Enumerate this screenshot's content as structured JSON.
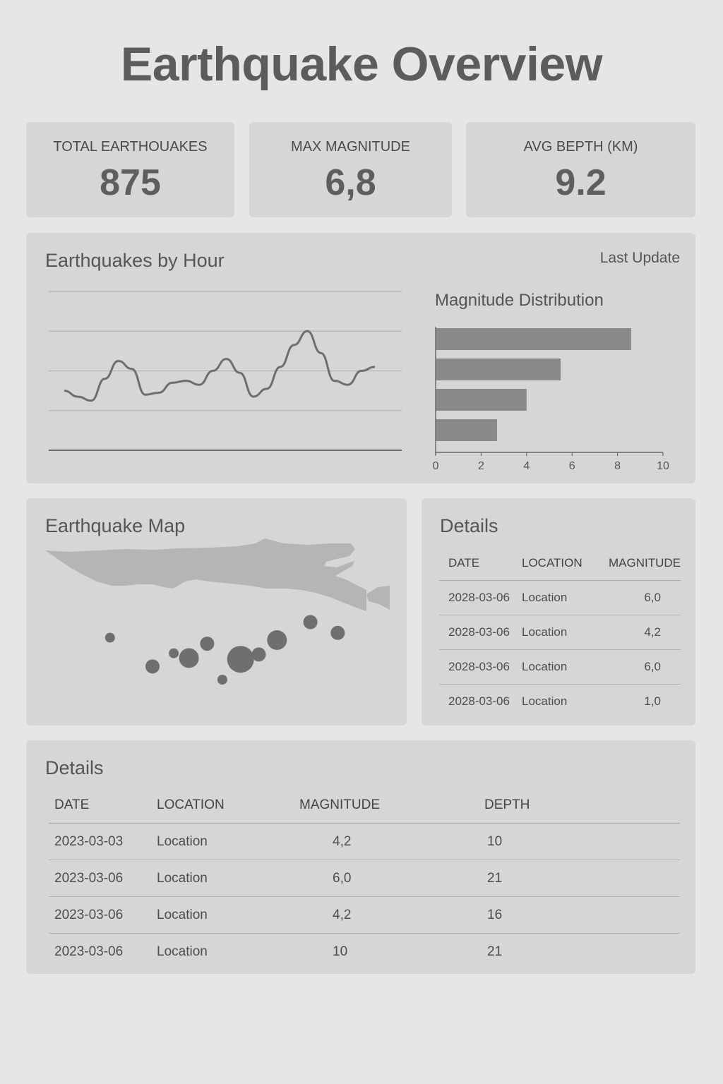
{
  "title": "Earthquake Overview",
  "kpis": [
    {
      "label": "TOTAL EARTHOUAKES",
      "value": "875"
    },
    {
      "label": "MAX MAGNITUDE",
      "value": "6,8"
    },
    {
      "label": "AVG BEPTH (KM)",
      "value": "9.2"
    }
  ],
  "hour_panel": {
    "title": "Earthquakes by Hour",
    "last_update": "Last Update"
  },
  "chart_data": [
    {
      "type": "line",
      "title": "Earthquakes by Hour",
      "x": [
        0,
        1,
        2,
        3,
        4,
        5,
        6,
        7,
        8,
        9,
        10,
        11,
        12,
        13,
        14,
        15,
        16,
        17,
        18,
        19,
        20,
        21,
        22,
        23
      ],
      "series": [
        {
          "values": [
            3.0,
            2.7,
            2.5,
            3.6,
            4.5,
            4.1,
            2.8,
            2.9,
            3.4,
            3.5,
            3.3,
            4.0,
            4.6,
            3.9,
            2.7,
            3.1,
            4.2,
            5.3,
            6.0,
            4.9,
            3.5,
            3.3,
            4.0,
            4.2
          ]
        }
      ],
      "ylim": [
        0,
        8
      ],
      "grid": true
    },
    {
      "type": "bar",
      "orientation": "horizontal",
      "title": "Magnitude Distribution",
      "categories": [
        "",
        "",
        "",
        ""
      ],
      "values": [
        8.6,
        5.5,
        4.0,
        2.7
      ],
      "xlim": [
        0,
        10
      ],
      "xticks": [
        "0",
        "2",
        "4",
        "6",
        "8",
        "10"
      ]
    }
  ],
  "map_panel": {
    "title": "Earthquake Map",
    "events": [
      {
        "lon": 0.16,
        "lat": 0.28,
        "size": 1
      },
      {
        "lon": 0.3,
        "lat": 0.52,
        "size": 2
      },
      {
        "lon": 0.37,
        "lat": 0.41,
        "size": 1
      },
      {
        "lon": 0.42,
        "lat": 0.45,
        "size": 3
      },
      {
        "lon": 0.48,
        "lat": 0.33,
        "size": 2
      },
      {
        "lon": 0.53,
        "lat": 0.63,
        "size": 1
      },
      {
        "lon": 0.59,
        "lat": 0.46,
        "size": 4
      },
      {
        "lon": 0.65,
        "lat": 0.42,
        "size": 2
      },
      {
        "lon": 0.71,
        "lat": 0.3,
        "size": 3
      },
      {
        "lon": 0.82,
        "lat": 0.15,
        "size": 2
      },
      {
        "lon": 0.91,
        "lat": 0.24,
        "size": 2
      }
    ]
  },
  "details_small": {
    "title": "Details",
    "columns": [
      "DATE",
      "LOCATION",
      "MAGNITUDE"
    ],
    "rows": [
      [
        "2028-03-06",
        "Location",
        "6,0"
      ],
      [
        "2028-03-06",
        "Location",
        "4,2"
      ],
      [
        "2028-03-06",
        "Location",
        "6,0"
      ],
      [
        "2028-03-06",
        "Location",
        "1,0"
      ]
    ]
  },
  "details_big": {
    "title": "Details",
    "columns": [
      "DATE",
      "LOCATION",
      "MAGNITUDE",
      "DEPTH"
    ],
    "rows": [
      [
        "2023-03-03",
        "Location",
        "4,2",
        "10"
      ],
      [
        "2023-03-06",
        "Location",
        "6,0",
        "21"
      ],
      [
        "2023-03-06",
        "Location",
        "4,2",
        "16"
      ],
      [
        "2023-03-06",
        "Location",
        "10",
        "21"
      ]
    ]
  },
  "colors": {
    "page_bg": "#e6e6e6",
    "card_bg": "#d6d6d6",
    "line": "#6e6e6e",
    "bar": "#8a8a8a",
    "map_land": "#b5b5b5",
    "map_dot": "#6f6f6f"
  }
}
